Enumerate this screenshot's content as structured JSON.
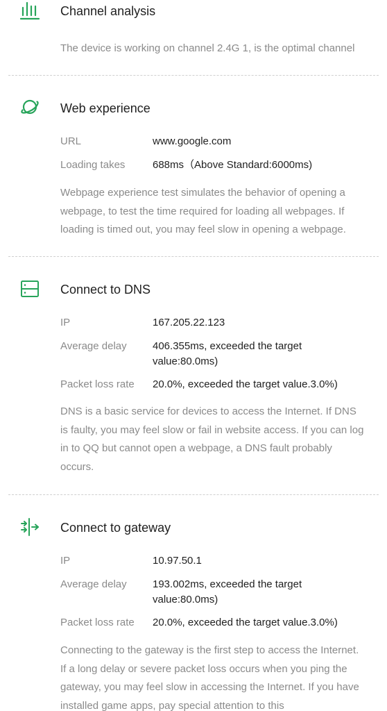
{
  "accent_color": "#27a45a",
  "channel": {
    "icon": "signal-bars-icon",
    "title": "Channel analysis",
    "description": "The device is working on channel 2.4G 1, is the optimal channel"
  },
  "web": {
    "icon": "planet-icon",
    "title": "Web experience",
    "rows": [
      {
        "label": "URL",
        "value": "www.google.com"
      },
      {
        "label": "Loading takes",
        "value": "688ms（Above Standard:6000ms)"
      }
    ],
    "description": "Webpage experience test simulates the behavior of opening a webpage, to test the time required for loading all webpages. If loading is timed out, you may feel slow in opening a webpage."
  },
  "dns": {
    "icon": "server-icon",
    "title": "Connect to DNS",
    "rows": [
      {
        "label": "IP",
        "value": "167.205.22.123"
      },
      {
        "label": "Average delay",
        "value": "406.355ms, exceeded the target value:80.0ms)"
      },
      {
        "label": "Packet loss rate",
        "value": "20.0%, exceeded the target value.3.0%)"
      }
    ],
    "description": "DNS is a basic service for devices to access the Internet. If DNS is faulty, you may feel slow or fail in website access. If you can log in to QQ but cannot open a webpage, a DNS fault probably occurs."
  },
  "gateway": {
    "icon": "gateway-arrows-icon",
    "title": "Connect to gateway",
    "rows": [
      {
        "label": "IP",
        "value": "10.97.50.1"
      },
      {
        "label": "Average delay",
        "value": "193.002ms, exceeded the target value:80.0ms)"
      },
      {
        "label": "Packet loss rate",
        "value": "20.0%, exceeded the target value.3.0%)"
      }
    ],
    "description": "Connecting to the gateway is the first step to access the Internet. If a long delay or severe packet loss occurs when you ping the gateway, you may feel slow in accessing the Internet. If you have installed game apps, pay special attention to this"
  }
}
